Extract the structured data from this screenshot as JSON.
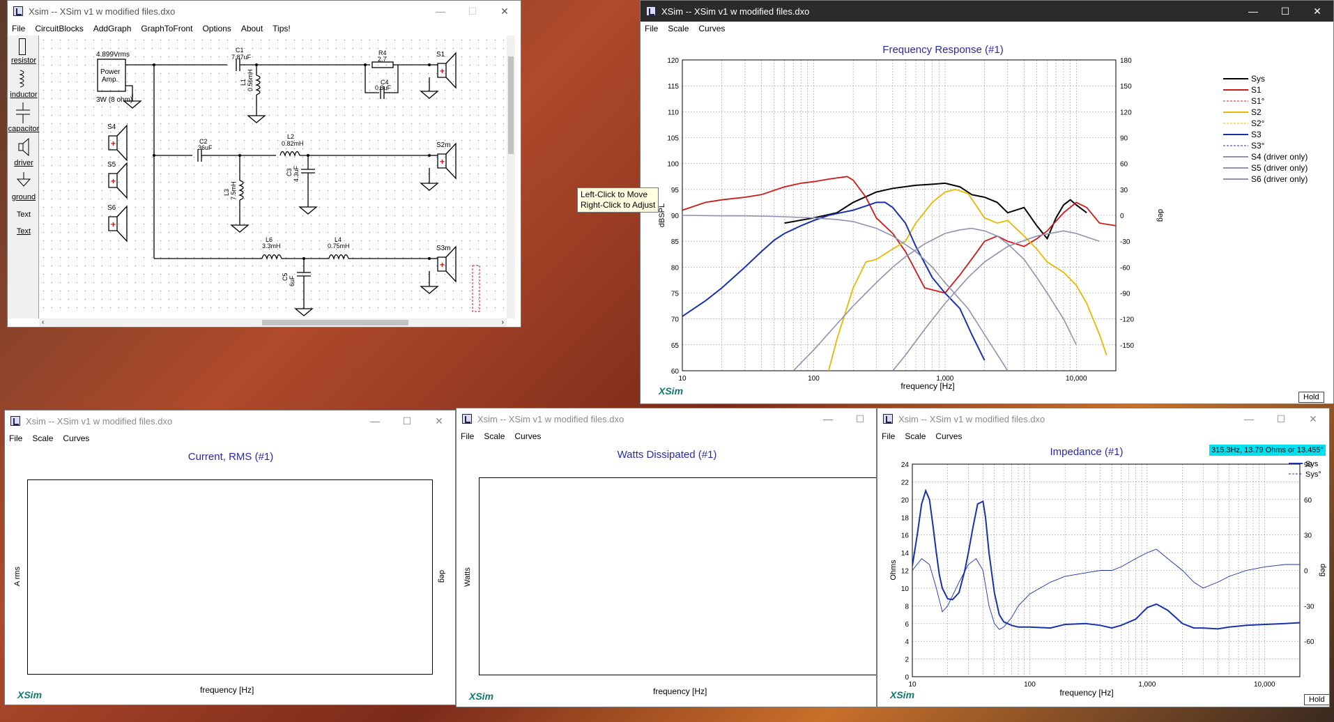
{
  "app_name": "XSim",
  "main_window": {
    "title": "Xsim -- XSim v1 w modified files.dxo",
    "menu": [
      "File",
      "CircuitBlocks",
      "AddGraph",
      "GraphToFront",
      "Options",
      "About",
      "Tips!"
    ],
    "toolbox": [
      "resistor",
      "inductor",
      "capacitor",
      "driver",
      "ground",
      "Text",
      "Text"
    ],
    "schematic": {
      "amp_voltage": "4.899Vrms",
      "amp_label_1": "Power",
      "amp_label_2": "Amp.",
      "amp_power": "3W (8 ohm)",
      "c1_name": "C1",
      "c1_value": "7.87uF",
      "l1_name": "L1",
      "l1_value": "0.56mH",
      "r4_name": "R4",
      "r4_value": "2.7",
      "c4_name": "C4",
      "c4_value": "0.3uF",
      "s1_name": "S1",
      "s4_name": "S4",
      "s5_name": "S5",
      "s6_name": "S6",
      "c2_name": "C2",
      "c2_value": "36uF",
      "l2_name": "L2",
      "l2_value": "0.82mH",
      "l3_name": "L3",
      "l3_value": "7.5mH",
      "c3_name": "C3",
      "c3_value": "4.3uF",
      "s2_name": "S2m",
      "l6_name": "L6",
      "l6_value": "3.3mH",
      "l4_name": "L4",
      "l4_value": "0.75mH",
      "c5_name": "C5",
      "c5_value": "6uF",
      "s3_name": "S3m"
    },
    "tooltip": [
      "Left-Click to Move",
      "Right-Click to Adjust"
    ]
  },
  "freq_window": {
    "title": "XSim -- XSim v1 w modified files.dxo",
    "menu": [
      "File",
      "Scale",
      "Curves"
    ],
    "hold_label": "Hold",
    "legend": [
      "Sys",
      "S1",
      "S1°",
      "S2",
      "S2°",
      "S3",
      "S3°",
      "S4 (driver only)",
      "S5 (driver only)",
      "S6 (driver only)"
    ],
    "colors": {
      "sys": "#000000",
      "s1": "#d01818",
      "s2": "#e8b800",
      "s3": "#1830b0",
      "driver": "#9090b0"
    }
  },
  "current_window": {
    "title": "Xsim -- XSim v1 w modified files.dxo",
    "menu": [
      "File",
      "Scale",
      "Curves"
    ]
  },
  "watts_window": {
    "title": "Xsim -- XSim v1 w modified files.dxo",
    "menu": [
      "File",
      "Scale",
      "Curves"
    ]
  },
  "imp_window": {
    "title": "Xsim -- XSim v1 w modified files.dxo",
    "menu": [
      "File",
      "Scale",
      "Curves"
    ],
    "readout": "315.3Hz, 13.79 Ohms or 13.455°",
    "hold_label": "Hold",
    "legend": [
      "Sys",
      "Sys°"
    ]
  },
  "chart_data": [
    {
      "type": "line",
      "title": "Frequency Response (#1)",
      "xlabel": "frequency [Hz]",
      "ylabel": "dBSPL",
      "y2label": "deg",
      "x_scale": "log",
      "xlim": [
        10,
        20000
      ],
      "ylim": [
        60,
        120
      ],
      "y2lim": [
        -180,
        180
      ],
      "x_ticks": [
        "10",
        "100",
        "1,000",
        "10,000"
      ],
      "y_ticks": [
        "120",
        "115",
        "110",
        "105",
        "100",
        "95",
        "90",
        "85",
        "80",
        "75",
        "70",
        "65",
        "60"
      ],
      "y2_ticks": [
        "180",
        "150",
        "120",
        "90",
        "60",
        "30",
        "0",
        "-30",
        "-60",
        "-90",
        "-120",
        "-150"
      ],
      "grid": true,
      "legend_position": "right",
      "series": [
        {
          "name": "Sys",
          "x": [
            60,
            100,
            150,
            200,
            300,
            400,
            600,
            800,
            1000,
            1300,
            1600,
            2000,
            2500,
            3000,
            4000,
            5000,
            6000,
            7000,
            8000,
            9000,
            10000,
            12000
          ],
          "y": [
            88.5,
            89.5,
            90.5,
            92.5,
            94.5,
            95.2,
            95.8,
            96.0,
            96.2,
            95.5,
            94.0,
            93.5,
            92.5,
            90.5,
            91.5,
            88.0,
            85.5,
            89.5,
            92.0,
            93.0,
            92.0,
            90.5
          ]
        },
        {
          "name": "S1",
          "x": [
            10,
            15,
            20,
            30,
            40,
            60,
            80,
            100,
            130,
            180,
            200,
            250,
            300,
            400,
            500,
            700,
            1000,
            1300,
            1700,
            2000,
            2500,
            3000,
            4000,
            5000,
            6000,
            8000,
            10000,
            12000,
            15000,
            20000
          ],
          "y": [
            91.0,
            92.5,
            93.0,
            93.5,
            94.0,
            95.5,
            96.2,
            96.5,
            97.0,
            97.5,
            96.8,
            93.5,
            89.5,
            86.5,
            83.0,
            76.0,
            75.0,
            78.5,
            82.5,
            85.0,
            86.0,
            85.0,
            84.0,
            85.5,
            87.0,
            90.5,
            92.5,
            91.5,
            88.5,
            88.0
          ]
        },
        {
          "name": "S2",
          "x": [
            130,
            150,
            200,
            250,
            300,
            400,
            500,
            600,
            800,
            1000,
            1200,
            1500,
            2000,
            2500,
            3000,
            4000,
            5000,
            6000,
            8000,
            10000,
            12000,
            15000,
            17000
          ],
          "y": [
            60,
            66,
            76,
            81,
            81.5,
            83.5,
            85.0,
            88.5,
            92.5,
            94.5,
            95.0,
            94.2,
            89.5,
            88.5,
            89.0,
            86.0,
            83.5,
            81.0,
            79.0,
            76.5,
            73.0,
            67.0,
            63.0
          ]
        },
        {
          "name": "S3",
          "x": [
            10,
            15,
            20,
            30,
            40,
            50,
            60,
            80,
            100,
            130,
            160,
            200,
            250,
            300,
            350,
            400,
            500,
            600,
            800,
            1000,
            1300,
            1600,
            2000
          ],
          "y": [
            70.5,
            73.5,
            76.0,
            80.0,
            83.0,
            85.2,
            86.5,
            88.0,
            89.0,
            90.0,
            90.5,
            91.0,
            91.8,
            92.5,
            92.5,
            91.5,
            88.5,
            84.0,
            78.0,
            75.0,
            72.0,
            67.0,
            62.0
          ]
        },
        {
          "name": "S4 (driver only)",
          "x": [
            10,
            20,
            30,
            50,
            80,
            100,
            150,
            200,
            300,
            400,
            600,
            800,
            1000,
            1500,
            2000,
            3000,
            4000,
            5000,
            6000,
            8000
          ],
          "y": [
            90,
            89.9,
            89.9,
            89.8,
            89.6,
            89.5,
            89.2,
            88.8,
            87.5,
            86.0,
            83.0,
            80.0,
            77.0,
            72.0,
            67.0,
            60.0,
            55.0,
            50.0,
            45.0,
            40.0
          ]
        },
        {
          "name": "S5 (driver only)",
          "x": [
            70,
            100,
            150,
            200,
            300,
            400,
            500,
            700,
            1000,
            1300,
            1600,
            2000,
            2500,
            3000,
            4000,
            5000,
            6000,
            8000,
            10000
          ],
          "y": [
            60,
            64,
            69,
            72.5,
            77,
            80,
            82,
            84.5,
            86.5,
            87.2,
            87.5,
            87.0,
            86.0,
            84.5,
            81.5,
            78.0,
            75.0,
            70.0,
            65.0
          ]
        },
        {
          "name": "S6 (driver only)",
          "x": [
            400,
            500,
            700,
            1000,
            1500,
            2000,
            3000,
            5000,
            8000,
            10000,
            15000
          ],
          "y": [
            60,
            63,
            68,
            73,
            78,
            81,
            84,
            86,
            87,
            86.5,
            85
          ]
        }
      ]
    },
    {
      "type": "line",
      "title": "Current, RMS (#1)",
      "xlabel": "frequency [Hz]",
      "ylabel": "A rms",
      "y2label": "deg",
      "series": []
    },
    {
      "type": "line",
      "title": "Watts Dissipated (#1)",
      "xlabel": "frequency [Hz]",
      "ylabel": "Watts",
      "series": []
    },
    {
      "type": "line",
      "title": "Impedance (#1)",
      "xlabel": "frequency [Hz]",
      "ylabel": "Ohms",
      "y2label": "deg",
      "x_scale": "log",
      "xlim": [
        10,
        20000
      ],
      "ylim": [
        0,
        24
      ],
      "y2lim": [
        -90,
        90
      ],
      "x_ticks": [
        "10",
        "100",
        "1,000",
        "10,000"
      ],
      "y_ticks": [
        "24",
        "22",
        "20",
        "18",
        "16",
        "14",
        "12",
        "10",
        "8",
        "6",
        "4",
        "2",
        "0"
      ],
      "y2_ticks": [
        "90",
        "60",
        "30",
        "0",
        "-30",
        "-60"
      ],
      "grid": true,
      "legend_position": "top-right",
      "series": [
        {
          "name": "Sys",
          "x": [
            10,
            11,
            12,
            13,
            14,
            15,
            16,
            17,
            18,
            20,
            22,
            25,
            28,
            30,
            33,
            36,
            40,
            42,
            45,
            50,
            55,
            60,
            70,
            80,
            100,
            150,
            200,
            300,
            400,
            500,
            600,
            800,
            1000,
            1200,
            1500,
            2000,
            2500,
            3000,
            4000,
            5000,
            7000,
            10000,
            15000,
            20000
          ],
          "y": [
            12.5,
            16,
            19.5,
            21,
            20,
            17,
            14,
            11.5,
            10,
            8.8,
            8.7,
            9.5,
            12,
            14,
            17,
            19.5,
            19.8,
            18,
            14,
            9.5,
            7,
            6.2,
            5.8,
            5.6,
            5.6,
            5.5,
            5.9,
            6.0,
            5.8,
            5.5,
            5.8,
            6.5,
            7.8,
            8.2,
            7.5,
            6.0,
            5.5,
            5.5,
            5.4,
            5.6,
            5.8,
            5.9,
            6.0,
            6.1
          ]
        },
        {
          "name": "Sys°",
          "x": [
            10,
            12,
            14,
            16,
            18,
            20,
            25,
            30,
            35,
            40,
            45,
            50,
            55,
            60,
            70,
            80,
            100,
            150,
            200,
            300,
            400,
            500,
            600,
            800,
            1000,
            1200,
            1500,
            2000,
            2500,
            3000,
            4000,
            5000,
            7000,
            10000,
            15000,
            20000
          ],
          "y": [
            0,
            10,
            5,
            -15,
            -35,
            -30,
            -10,
            5,
            10,
            0,
            -30,
            -45,
            -50,
            -48,
            -40,
            -30,
            -20,
            -10,
            -5,
            -2,
            0,
            0,
            3,
            10,
            15,
            18,
            10,
            0,
            -10,
            -15,
            -10,
            -5,
            0,
            3,
            5,
            5
          ]
        }
      ]
    }
  ]
}
